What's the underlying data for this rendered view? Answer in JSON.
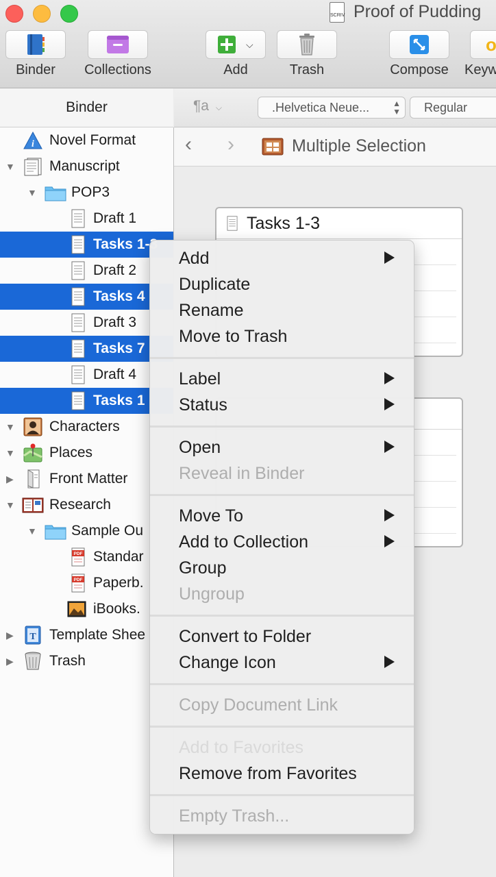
{
  "window": {
    "title": "Proof of Pudding",
    "doc_badge": "SCRIV"
  },
  "toolbar": {
    "binder": "Binder",
    "collections": "Collections",
    "add": "Add",
    "trash": "Trash",
    "compose": "Compose",
    "keywords": "Keyw"
  },
  "binder": {
    "header": "Binder",
    "items": [
      {
        "label": "Novel Format",
        "icon": "info-icon"
      },
      {
        "label": "Manuscript",
        "icon": "manuscript-icon"
      },
      {
        "label": "POP3",
        "icon": "folder-icon"
      },
      {
        "label": "Draft 1",
        "icon": "document-icon"
      },
      {
        "label": "Tasks 1-3",
        "icon": "document-icon"
      },
      {
        "label": "Draft 2",
        "icon": "document-icon"
      },
      {
        "label": "Tasks 4",
        "icon": "document-icon"
      },
      {
        "label": "Draft 3",
        "icon": "document-icon"
      },
      {
        "label": "Tasks 7",
        "icon": "document-icon"
      },
      {
        "label": "Draft 4",
        "icon": "document-icon"
      },
      {
        "label": "Tasks 1",
        "icon": "document-icon"
      },
      {
        "label": "Characters",
        "icon": "character-icon"
      },
      {
        "label": "Places",
        "icon": "places-icon"
      },
      {
        "label": "Front Matter",
        "icon": "front-matter-icon"
      },
      {
        "label": "Research",
        "icon": "research-icon"
      },
      {
        "label": "Sample Ou",
        "icon": "folder-icon"
      },
      {
        "label": "Standar",
        "icon": "pdf-icon"
      },
      {
        "label": "Paperb.",
        "icon": "pdf-icon"
      },
      {
        "label": "iBooks.",
        "icon": "image-icon"
      },
      {
        "label": "Template Shee",
        "icon": "template-icon"
      },
      {
        "label": "Trash",
        "icon": "trash-icon"
      }
    ]
  },
  "format_bar": {
    "paragraph_symbol": "¶a",
    "font": ".Helvetica Neue...",
    "style": "Regular"
  },
  "editor": {
    "title": "Multiple Selection",
    "card1_title": "Tasks 1-3"
  },
  "context_menu": {
    "add": "Add",
    "duplicate": "Duplicate",
    "rename": "Rename",
    "move_to_trash": "Move to Trash",
    "label": "Label",
    "status": "Status",
    "open": "Open",
    "reveal_in_binder": "Reveal in Binder",
    "move_to": "Move To",
    "add_to_collection": "Add to Collection",
    "group": "Group",
    "ungroup": "Ungroup",
    "convert_to_folder": "Convert to Folder",
    "change_icon": "Change Icon",
    "copy_document_link": "Copy Document Link",
    "add_to_favorites": "Add to Favorites",
    "remove_from_favorites": "Remove from Favorites",
    "empty_trash": "Empty Trash..."
  },
  "colors": {
    "selection": "#1a68d7",
    "close": "#fc605b",
    "minimize": "#fdbc40",
    "zoom": "#34c84a"
  }
}
